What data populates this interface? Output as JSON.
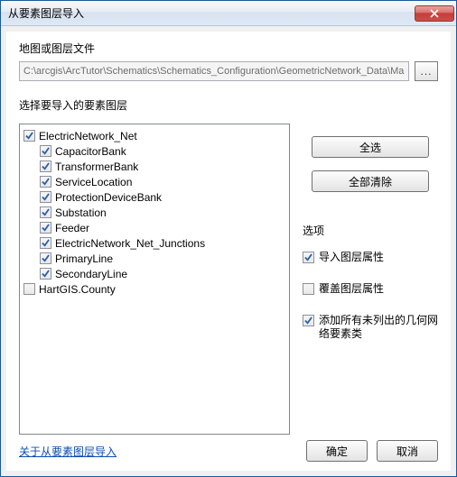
{
  "title": "从要素图层导入",
  "file_section_label": "地图或图层文件",
  "file_path": "C:\\arcgis\\ArcTutor\\Schematics\\Schematics_Configuration\\GeometricNetwork_Data\\Ma",
  "browse_label": "...",
  "layers_section_label": "选择要导入的要素图层",
  "tree": [
    {
      "label": "ElectricNetwork_Net",
      "checked": true,
      "indent": false
    },
    {
      "label": "CapacitorBank",
      "checked": true,
      "indent": true
    },
    {
      "label": "TransformerBank",
      "checked": true,
      "indent": true
    },
    {
      "label": "ServiceLocation",
      "checked": true,
      "indent": true
    },
    {
      "label": "ProtectionDeviceBank",
      "checked": true,
      "indent": true
    },
    {
      "label": "Substation",
      "checked": true,
      "indent": true
    },
    {
      "label": "Feeder",
      "checked": true,
      "indent": true
    },
    {
      "label": "ElectricNetwork_Net_Junctions",
      "checked": true,
      "indent": true
    },
    {
      "label": "PrimaryLine",
      "checked": true,
      "indent": true
    },
    {
      "label": "SecondaryLine",
      "checked": true,
      "indent": true
    },
    {
      "label": "HartGIS.County",
      "checked": false,
      "indent": false
    }
  ],
  "buttons": {
    "select_all": "全选",
    "clear_all": "全部清除",
    "ok": "确定",
    "cancel": "取消"
  },
  "options": {
    "group_label": "选项",
    "items": [
      {
        "label": "导入图层属性",
        "checked": true
      },
      {
        "label": "覆盖图层属性",
        "checked": false
      },
      {
        "label": "添加所有未列出的几何网络要素类",
        "checked": true
      }
    ]
  },
  "help_link": "关于从要素图层导入"
}
